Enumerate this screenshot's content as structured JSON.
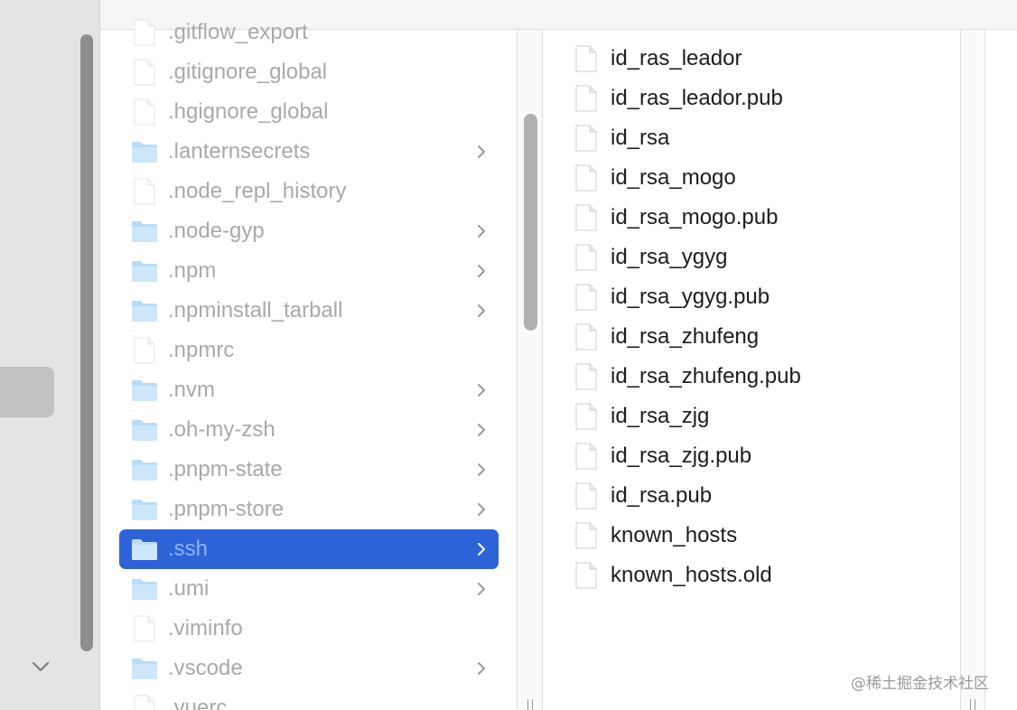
{
  "parent_column": {
    "items": [
      {
        "name": ".gitflow_export",
        "kind": "file"
      },
      {
        "name": ".gitignore_global",
        "kind": "file"
      },
      {
        "name": ".hgignore_global",
        "kind": "file"
      },
      {
        "name": ".lanternsecrets",
        "kind": "folder"
      },
      {
        "name": ".node_repl_history",
        "kind": "file"
      },
      {
        "name": ".node-gyp",
        "kind": "folder"
      },
      {
        "name": ".npm",
        "kind": "folder"
      },
      {
        "name": ".npminstall_tarball",
        "kind": "folder"
      },
      {
        "name": ".npmrc",
        "kind": "file"
      },
      {
        "name": ".nvm",
        "kind": "folder"
      },
      {
        "name": ".oh-my-zsh",
        "kind": "folder"
      },
      {
        "name": ".pnpm-state",
        "kind": "folder"
      },
      {
        "name": ".pnpm-store",
        "kind": "folder"
      },
      {
        "name": ".ssh",
        "kind": "folder",
        "selected": true
      },
      {
        "name": ".umi",
        "kind": "folder"
      },
      {
        "name": ".viminfo",
        "kind": "file"
      },
      {
        "name": ".vscode",
        "kind": "folder"
      },
      {
        "name": ".yuerc",
        "kind": "file"
      }
    ]
  },
  "ssh_column": {
    "items": [
      {
        "name": "id_ras_leador"
      },
      {
        "name": "id_ras_leador.pub"
      },
      {
        "name": "id_rsa"
      },
      {
        "name": "id_rsa_mogo"
      },
      {
        "name": "id_rsa_mogo.pub"
      },
      {
        "name": "id_rsa_ygyg"
      },
      {
        "name": "id_rsa_ygyg.pub"
      },
      {
        "name": "id_rsa_zhufeng"
      },
      {
        "name": "id_rsa_zhufeng.pub"
      },
      {
        "name": "id_rsa_zjg"
      },
      {
        "name": "id_rsa_zjg.pub"
      },
      {
        "name": "id_rsa.pub"
      },
      {
        "name": "known_hosts"
      },
      {
        "name": "known_hosts.old"
      }
    ]
  },
  "watermark": "@稀土掘金技术社区",
  "icons": {
    "folder": "folder-icon",
    "file": "document-icon",
    "disclosure": "chevron-right-icon",
    "sidebar_toggle": "chevron-down-icon"
  },
  "colors": {
    "selection": "#2e63d8",
    "folder_fill": "#a9d3f5",
    "dim_text": "#a9a9a9",
    "text": "#1d1d1d"
  }
}
